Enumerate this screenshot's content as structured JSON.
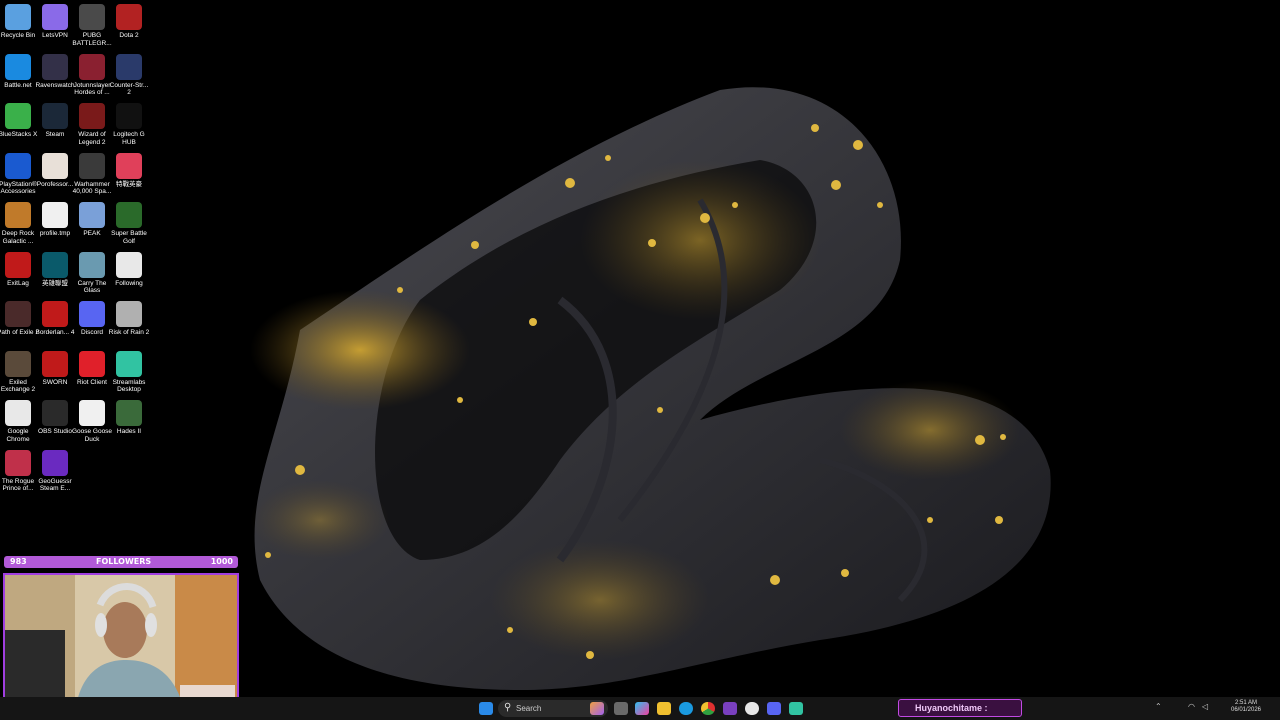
{
  "desktop_icons": [
    {
      "label": "Recycle Bin",
      "icon": "recycle-bin-icon",
      "color": "#5aa0e0"
    },
    {
      "label": "LetsVPN",
      "icon": "letsvpn-icon",
      "color": "#8a6ae8"
    },
    {
      "label": "PUBG BATTLEGR...",
      "icon": "pubg-icon",
      "color": "#4a4a4a"
    },
    {
      "label": "Dota 2",
      "icon": "dota-icon",
      "color": "#b22222"
    },
    {
      "label": "Battle.net",
      "icon": "battlenet-icon",
      "color": "#1a8ae0"
    },
    {
      "label": "Ravenswatch",
      "icon": "ravenswatch-icon",
      "color": "#333048"
    },
    {
      "label": "Jotunnslayer Hordes of ...",
      "icon": "jotunnslayer-icon",
      "color": "#8a2030"
    },
    {
      "label": "Counter-Str... 2",
      "icon": "counter-strike-icon",
      "color": "#2a3a6a"
    },
    {
      "label": "BlueStacks X",
      "icon": "bluestacks-icon",
      "color": "#3ab04a"
    },
    {
      "label": "Steam",
      "icon": "steam-icon",
      "color": "#1b2838"
    },
    {
      "label": "Wizard of Legend 2",
      "icon": "wizard-of-legend-icon",
      "color": "#7a1a1a"
    },
    {
      "label": "Logitech G HUB",
      "icon": "logitech-icon",
      "color": "#111111"
    },
    {
      "label": "PlayStation® Accessories",
      "icon": "playstation-icon",
      "color": "#1a5ad0"
    },
    {
      "label": "Porofessor...",
      "icon": "porofessor-icon",
      "color": "#e8e0d8"
    },
    {
      "label": "Warhammer 40,000 Spa...",
      "icon": "warhammer-icon",
      "color": "#3a3a3a"
    },
    {
      "label": "特戰英豪",
      "icon": "valorant-icon",
      "color": "#e0405a"
    },
    {
      "label": "Deep Rock Galactic ...",
      "icon": "deep-rock-icon",
      "color": "#c07a2a"
    },
    {
      "label": "profile.tmp",
      "icon": "file-icon",
      "color": "#f0f0f0"
    },
    {
      "label": "PEAK",
      "icon": "peak-icon",
      "color": "#7aa0d8"
    },
    {
      "label": "Super Battle Golf",
      "icon": "golf-icon",
      "color": "#2a6a2a"
    },
    {
      "label": "ExitLag",
      "icon": "exitlag-icon",
      "color": "#c01a1a"
    },
    {
      "label": "英雄聯盟",
      "icon": "league-icon",
      "color": "#0a5a6a"
    },
    {
      "label": "Carry The Glass",
      "icon": "carry-glass-icon",
      "color": "#6a9ab0"
    },
    {
      "label": "Following",
      "icon": "chrome-following-icon",
      "color": "#e8e8e8"
    },
    {
      "label": "Path of Exile 2",
      "icon": "poe-icon",
      "color": "#4a2a2a"
    },
    {
      "label": "Borderlan... 4",
      "icon": "borderlands-icon",
      "color": "#c01a1a"
    },
    {
      "label": "Discord",
      "icon": "discord-icon",
      "color": "#5865f2"
    },
    {
      "label": "Risk of Rain 2",
      "icon": "risk-of-rain-icon",
      "color": "#b0b0b0"
    },
    {
      "label": "Exiled Exchange 2",
      "icon": "exiled-exchange-icon",
      "color": "#5a4a3a"
    },
    {
      "label": "SWORN",
      "icon": "sworn-icon",
      "color": "#c01a1a"
    },
    {
      "label": "Riot Client",
      "icon": "riot-icon",
      "color": "#e0202a"
    },
    {
      "label": "Streamlabs Desktop",
      "icon": "streamlabs-icon",
      "color": "#31c3a2"
    },
    {
      "label": "Google Chrome",
      "icon": "chrome-icon",
      "color": "#e8e8e8"
    },
    {
      "label": "OBS Studio",
      "icon": "obs-icon",
      "color": "#2a2a2a"
    },
    {
      "label": "Goose Goose Duck",
      "icon": "goose-icon",
      "color": "#f0f0f0"
    },
    {
      "label": "Hades II",
      "icon": "hades-icon",
      "color": "#3a6a3a"
    },
    {
      "label": "The Rogue Prince of...",
      "icon": "rogue-prince-icon",
      "color": "#c0304a"
    },
    {
      "label": "GeoGuessr Steam E...",
      "icon": "geoguessr-icon",
      "color": "#6a2ac0"
    }
  ],
  "stream_overlay": {
    "follower_count": "983",
    "follower_label": "FOLLOWERS",
    "follower_goal": "1000"
  },
  "taskbar": {
    "search_placeholder": "Search",
    "chat_name": "Huyanochitame :",
    "clock_time": "2:51 AM",
    "clock_date": "06/01/2026"
  },
  "colors": {
    "overlay_accent": "#b25ad8",
    "wallpaper_gold": "#d4a830",
    "taskbar_bg": "#151515"
  }
}
